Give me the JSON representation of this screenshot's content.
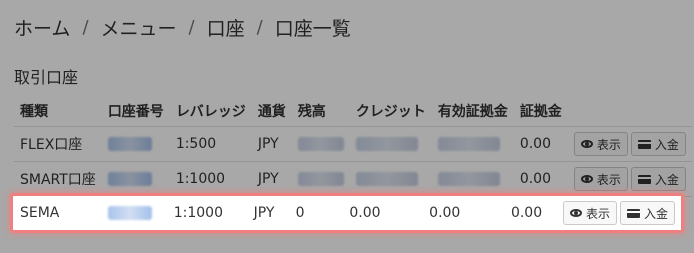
{
  "breadcrumb": {
    "items": [
      "ホーム",
      "メニュー",
      "口座",
      "口座一覧"
    ],
    "separator": "/"
  },
  "section_title": "取引口座",
  "table": {
    "headers": [
      "種類",
      "口座番号",
      "レバレッジ",
      "通貨",
      "残高",
      "クレジット",
      "有効証拠金",
      "証拠金"
    ],
    "rows": [
      {
        "type": "FLEX口座",
        "account": "",
        "leverage": "1:500",
        "currency": "JPY",
        "balance": "",
        "credit": "",
        "equity": "",
        "margin": "0.00"
      },
      {
        "type": "SMART口座",
        "account": "",
        "leverage": "1:1000",
        "currency": "JPY",
        "balance": "",
        "credit": "",
        "equity": "",
        "margin": "0.00"
      },
      {
        "type": "SEMA",
        "account": "",
        "leverage": "1:1000",
        "currency": "JPY",
        "balance": "0",
        "credit": "0.00",
        "equity": "0.00",
        "margin": "0.00"
      }
    ],
    "buttons": {
      "view": "表示",
      "deposit": "入金"
    }
  },
  "icons": {
    "view": "eye-icon",
    "deposit": "credit-card-icon"
  },
  "colors": {
    "highlight_border": "#f08080",
    "overlay": "rgba(0,0,0,0.34)"
  }
}
